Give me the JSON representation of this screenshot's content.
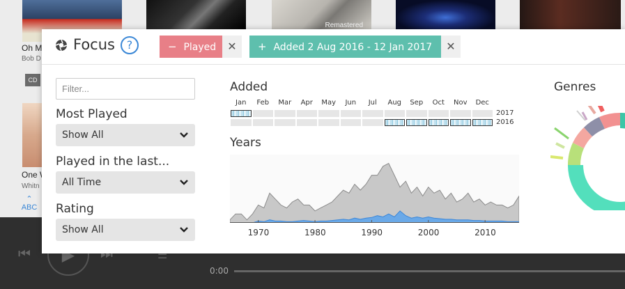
{
  "library": {
    "remastered_label": "Remastered",
    "album1_title": "Oh M",
    "album1_artist": "Bob D",
    "cd_badge": "CD",
    "album2_title": "One W",
    "album2_artist": "Whitn",
    "alpha_nav": "ABC"
  },
  "player": {
    "time": "0:00"
  },
  "focus": {
    "title": "Focus",
    "help": "?",
    "chips": {
      "played": {
        "sign": "−",
        "label": "Played",
        "color": "#e87f87"
      },
      "added": {
        "sign": "+",
        "label": "Added 2 Aug 2016 - 12 Jan  2017",
        "color": "#5ebfad"
      }
    },
    "filter_placeholder": "Filter...",
    "most_played": {
      "label": "Most Played",
      "value": "Show All"
    },
    "played_in_last": {
      "label": "Played in the last...",
      "value": "All Time"
    },
    "rating": {
      "label": "Rating",
      "value": "Show All"
    },
    "added": {
      "title": "Added",
      "months": [
        "Jan",
        "Feb",
        "Mar",
        "Apr",
        "May",
        "Jun",
        "Jul",
        "Aug",
        "Sep",
        "Oct",
        "Nov",
        "Dec"
      ],
      "years": [
        "2017",
        "2016"
      ]
    },
    "years_chart": {
      "title": "Years",
      "tick_labels": [
        "1970",
        "1980",
        "1990",
        "2000",
        "2010"
      ]
    },
    "genres": {
      "title": "Genres"
    }
  },
  "chart_data": {
    "type": "area",
    "title": "Years",
    "x": [
      1965,
      1966,
      1967,
      1968,
      1969,
      1970,
      1971,
      1972,
      1973,
      1974,
      1975,
      1976,
      1977,
      1978,
      1979,
      1980,
      1981,
      1982,
      1983,
      1984,
      1985,
      1986,
      1987,
      1988,
      1989,
      1990,
      1991,
      1992,
      1993,
      1994,
      1995,
      1996,
      1997,
      1998,
      1999,
      2000,
      2001,
      2002,
      2003,
      2004,
      2005,
      2006,
      2007,
      2008,
      2009,
      2010,
      2011,
      2012,
      2013,
      2014,
      2015,
      2016
    ],
    "series": [
      {
        "values": [
          0.5,
          1.5,
          1.5,
          0.5,
          1.5,
          3,
          2.5,
          5,
          4,
          3,
          2.5,
          3.5,
          4,
          3,
          3,
          2,
          2.5,
          3,
          3.5,
          4.5,
          5.5,
          5,
          6.5,
          5.5,
          6.5,
          8,
          8,
          9.5,
          10,
          8,
          6,
          7,
          5,
          6,
          4.5,
          6,
          5,
          5.5,
          4,
          5,
          3.5,
          4,
          5,
          3.5,
          4,
          3,
          3.5,
          3,
          3,
          2.5,
          3,
          4.5
        ]
      },
      {
        "values": [
          0,
          0,
          0,
          0,
          0,
          0.3,
          0.2,
          0.5,
          0.3,
          0.3,
          0.2,
          0.2,
          0.3,
          0.4,
          0.3,
          0.2,
          0.3,
          0.3,
          0.4,
          0.5,
          0.6,
          0.5,
          0.8,
          0.6,
          0.8,
          0.9,
          1.2,
          1.0,
          1.5,
          1.0,
          2.0,
          1.2,
          0.8,
          1.0,
          0.8,
          1.0,
          0.8,
          0.7,
          0.6,
          0.6,
          0.5,
          0.5,
          0.5,
          0.4,
          0.4,
          0.3,
          0.3,
          0.3,
          0.3,
          0.2,
          0.2,
          0.2
        ]
      }
    ],
    "xlim": [
      1965,
      2016
    ],
    "ylim": [
      0,
      11
    ],
    "colors": {
      "all": "#c8c8c8",
      "played": "#6aa9e8"
    }
  }
}
